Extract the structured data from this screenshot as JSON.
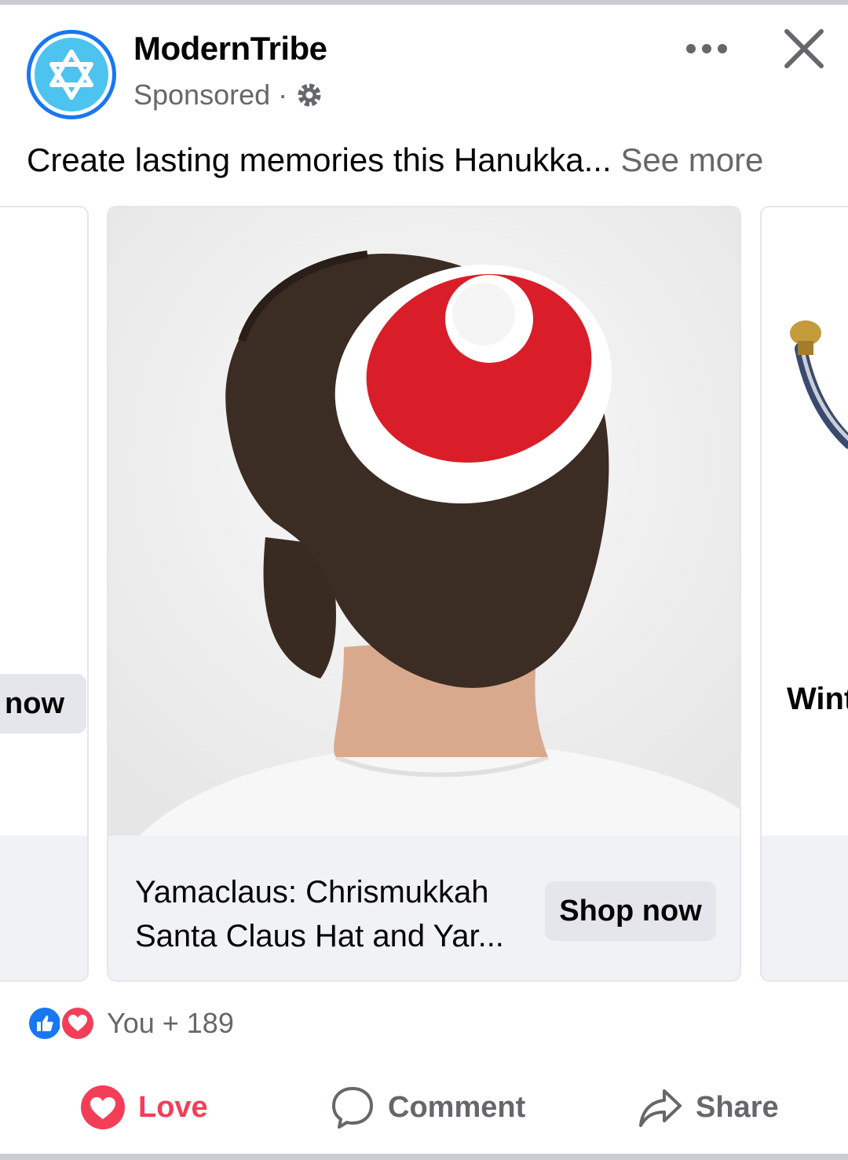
{
  "post": {
    "page_name": "ModernTribe",
    "sponsored_label": "Sponsored",
    "separator": "·",
    "caption": "Create lasting memories this Hanukka...",
    "see_more": "See more"
  },
  "carousel": {
    "left_card": {
      "button_label": "now"
    },
    "main_card": {
      "title": "Yamaclaus: Chrismukkah Santa Claus Hat and Yar...",
      "button_label": "Shop now"
    },
    "right_card": {
      "title": "Wint"
    }
  },
  "reactions": {
    "count_label": "You + 189"
  },
  "actions": {
    "love": "Love",
    "comment": "Comment",
    "share": "Share"
  },
  "colors": {
    "brand_blue": "#1877f2",
    "avatar_cyan": "#4dc3f0",
    "love_red": "#f33e58",
    "secondary_text": "#65676b"
  },
  "icons": [
    "star-of-david-icon",
    "gear-icon",
    "more-options-icon",
    "close-icon",
    "like-reaction-icon",
    "love-reaction-icon",
    "heart-icon",
    "comment-icon",
    "share-icon"
  ]
}
